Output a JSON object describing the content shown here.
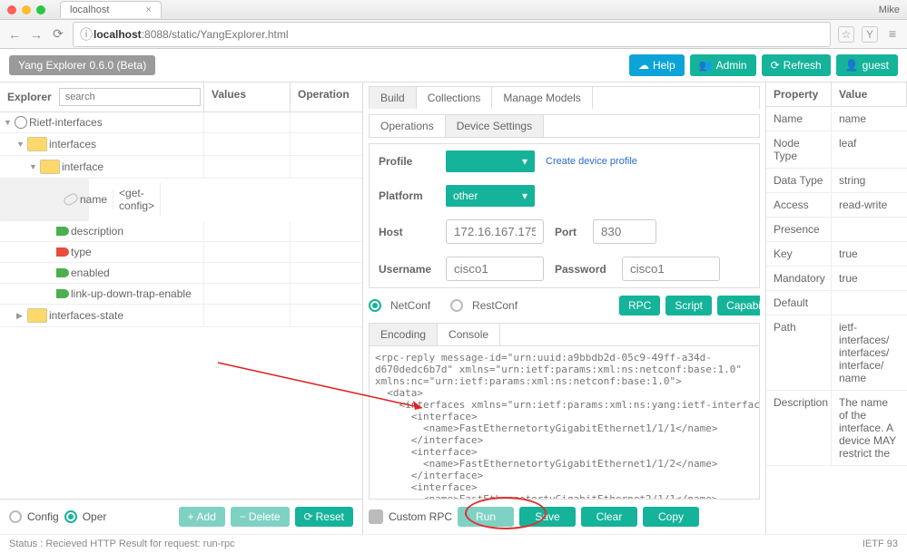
{
  "chrome": {
    "title": "localhost",
    "user": "Mike",
    "lock": "ⓘ",
    "host": "localhost",
    "port": ":8088",
    "path": "/static/YangExplorer.html"
  },
  "app": {
    "title": "Yang Explorer 0.6.0 (Beta)",
    "buttons": {
      "help": "Help",
      "admin": "Admin",
      "refresh": "Refresh",
      "guest": "guest"
    }
  },
  "explorer": {
    "head": "Explorer",
    "values": "Values",
    "operation": "Operation",
    "search": "search",
    "rows": [
      {
        "pad": 4,
        "tri": "▼",
        "ico": "globe",
        "txt": "Rietf-interfaces"
      },
      {
        "pad": 18,
        "tri": "▼",
        "ico": "fold",
        "txt": "interfaces"
      },
      {
        "pad": 32,
        "tri": "▼",
        "ico": "fold",
        "txt": "interface"
      },
      {
        "pad": 50,
        "ico": "key",
        "txt": "name",
        "v2": "<get-config>",
        "sel": true
      },
      {
        "pad": 50,
        "ico": "leafg",
        "txt": "description"
      },
      {
        "pad": 50,
        "ico": "leafr",
        "txt": "type"
      },
      {
        "pad": 50,
        "ico": "leafg",
        "txt": "enabled"
      },
      {
        "pad": 50,
        "ico": "leafg",
        "txt": "link-up-down-trap-enable"
      },
      {
        "pad": 18,
        "tri": "▶",
        "ico": "fold",
        "txt": "interfaces-state"
      }
    ],
    "foot": {
      "config": "Config",
      "oper": "Oper",
      "add": "Add",
      "del": "Delete",
      "reset": "Reset"
    }
  },
  "center": {
    "tabs": [
      "Build",
      "Collections",
      "Manage Models"
    ],
    "subtabs": [
      "Operations",
      "Device Settings"
    ],
    "profile": {
      "lbl": "Profile",
      "link": "Create device profile"
    },
    "platform": {
      "lbl": "Platform",
      "val": "other"
    },
    "host": {
      "lbl": "Host",
      "val": "172.16.167.175"
    },
    "port": {
      "lbl": "Port",
      "val": "830"
    },
    "user": {
      "lbl": "Username",
      "val": "cisco1"
    },
    "pass": {
      "lbl": "Password",
      "val": "cisco1"
    },
    "proto": {
      "nc": "NetConf",
      "rc": "RestConf"
    },
    "pbtns": {
      "rpc": "RPC",
      "script": "Script",
      "cap": "Capabilities"
    },
    "tabs2": [
      "Encoding",
      "Console"
    ],
    "code": "<rpc-reply message-id=\"urn:uuid:a9bbdb2d-05c9-49ff-a34d-\nd670dedc6b7d\" xmlns=\"urn:ietf:params:xml:ns:netconf:base:1.0\"\nxmlns:nc=\"urn:ietf:params:xml:ns:netconf:base:1.0\">\n  <data>\n    <interfaces xmlns=\"urn:ietf:params:xml:ns:yang:ietf-interfaces\">\n      <interface>\n        <name>FastEthernetortyGigabitEthernet1/1/1</name>\n      </interface>\n      <interface>\n        <name>FastEthernetortyGigabitEthernet1/1/2</name>\n      </interface>\n      <interface>\n        <name>FastEthernetortyGigabitEthernet2/1/1</name>\n      </interface>\n      <interface>",
    "cfoot": {
      "custom": "Custom RPC",
      "run": "Run",
      "save": "Save",
      "clear": "Clear",
      "copy": "Copy"
    }
  },
  "props": {
    "head": {
      "p": "Property",
      "v": "Value"
    },
    "rows": [
      [
        "Name",
        "name"
      ],
      [
        "Node Type",
        "leaf"
      ],
      [
        "Data Type",
        "string"
      ],
      [
        "Access",
        "read-write"
      ],
      [
        "Presence",
        ""
      ],
      [
        "Key",
        "true"
      ],
      [
        "Mandatory",
        "true"
      ],
      [
        "Default",
        ""
      ],
      [
        "Path",
        "ietf-interfaces/ interfaces/ interface/ name"
      ],
      [
        "Description",
        "The name of the interface.\n\nA device MAY restrict the"
      ]
    ]
  },
  "status": {
    "txt": "Status : Recieved HTTP Result for request: run-rpc",
    "ietf": "IETF 93"
  }
}
